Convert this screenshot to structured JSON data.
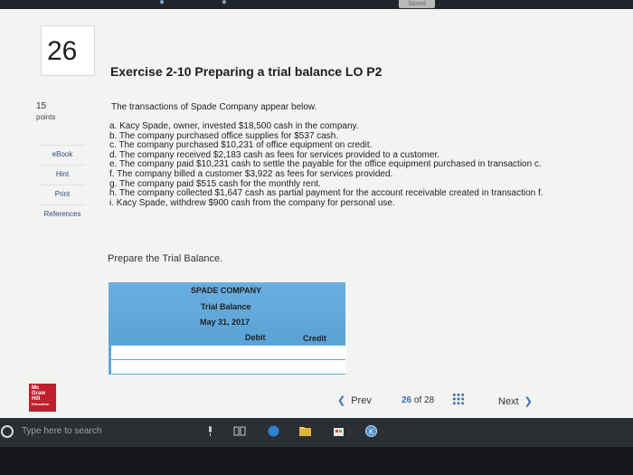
{
  "top_bar": {
    "saved_label": "Saved"
  },
  "question": {
    "number": "26",
    "title": "Exercise 2-10 Preparing a trial balance LO P2"
  },
  "points": {
    "value": "15",
    "label": "points"
  },
  "side_buttons": [
    "eBook",
    "Hint",
    "Print",
    "References"
  ],
  "problem": {
    "intro": "The transactions of Spade Company appear below.",
    "transactions": [
      "a. Kacy Spade, owner, invested $18,500 cash in the company.",
      "b. The company purchased office supplies for $537 cash.",
      "c. The company purchased $10,231 of office equipment on credit.",
      "d. The company received $2,183 cash as fees for services provided to a customer.",
      "e. The company paid $10,231 cash to settle the payable for the office equipment purchased in transaction c.",
      "f. The company billed a customer $3,922 as fees for services provided.",
      "g. The company paid $515 cash for the monthly rent.",
      "h. The company collected $1,647 cash as partial payment for the account receivable created in transaction f.",
      "i. Kacy Spade, withdrew $900 cash from the company for personal use."
    ],
    "prepare": "Prepare the Trial Balance."
  },
  "trial_balance": {
    "company": "SPADE COMPANY",
    "title": "Trial Balance",
    "date": "May 31, 2017",
    "col_debit": "Debit",
    "col_credit": "Credit",
    "rows": [
      {
        "account": "",
        "debit": "",
        "credit": ""
      },
      {
        "account": "",
        "debit": "",
        "credit": ""
      }
    ]
  },
  "navigation": {
    "prev_label": "Prev",
    "page_current": "26",
    "page_sep": "of",
    "page_total": "28",
    "next_label": "Next"
  },
  "publisher_logo": {
    "lines": [
      "Mc",
      "Graw",
      "Hill",
      "Education"
    ]
  },
  "taskbar": {
    "search_placeholder": "Type here to search"
  },
  "colors": {
    "table_blue": "#5fa8da",
    "link_blue": "#3b6fb6",
    "logo_red": "#c0202a"
  }
}
